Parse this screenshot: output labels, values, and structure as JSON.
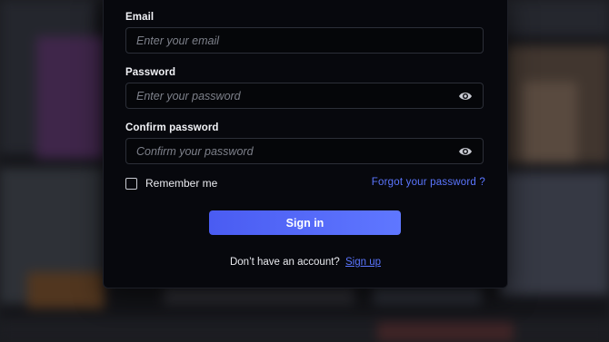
{
  "form": {
    "email": {
      "label": "Email",
      "value": "",
      "placeholder": "Enter your email"
    },
    "password": {
      "label": "Password",
      "value": "",
      "placeholder": "Enter your password",
      "toggle_icon": "eye-icon"
    },
    "confirm_password": {
      "label": "Confirm password",
      "value": "",
      "placeholder": "Confirm your password",
      "toggle_icon": "eye-icon"
    },
    "remember_me": {
      "label": "Remember me",
      "checked": false
    },
    "forgot_link": "Forgot your password ?",
    "submit_label": "Sign in",
    "signup_prompt": "Don’t have an account?",
    "signup_link": "Sign up"
  },
  "colors": {
    "accent": "#5b76ff",
    "card_bg": "#07080d",
    "field_border": "#2c2f38"
  }
}
